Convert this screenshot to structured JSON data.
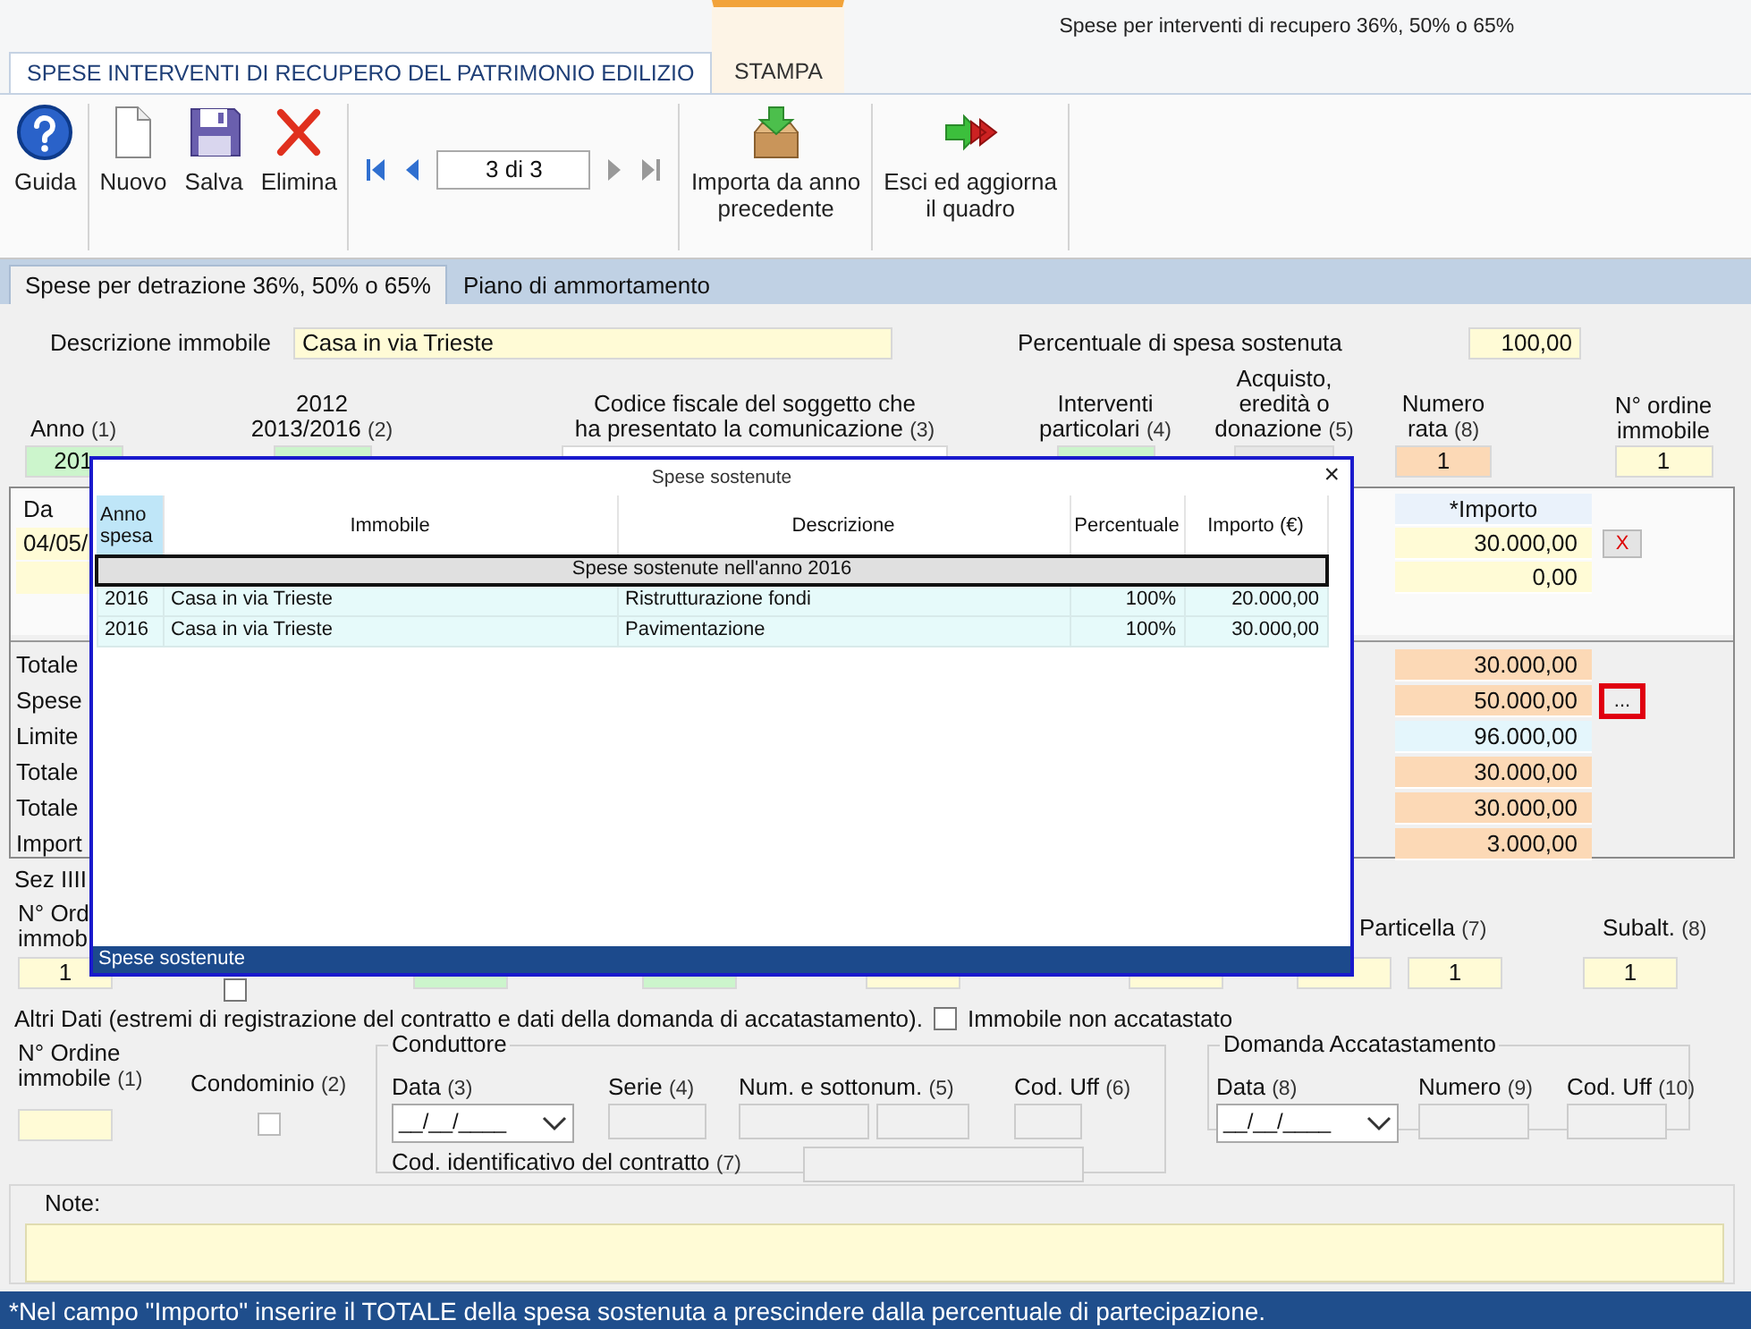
{
  "window": {
    "title": "Spese per interventi di recupero 36%, 50% o 65%"
  },
  "ribbon_tabs": [
    {
      "label": "SPESE INTERVENTI DI RECUPERO DEL PATRIMONIO EDILIZIO",
      "selected": true,
      "contextual": false
    },
    {
      "label": "STAMPA",
      "selected": false,
      "contextual": true
    }
  ],
  "toolbar_groups": [
    [
      {
        "kind": "help",
        "lines": [
          "Guida"
        ]
      }
    ],
    [
      {
        "kind": "new",
        "lines": [
          "Nuovo"
        ]
      },
      {
        "kind": "save",
        "lines": [
          "Salva"
        ]
      },
      {
        "kind": "delete",
        "lines": [
          "Elimina"
        ]
      }
    ],
    [
      {
        "kind": "pager",
        "value": "3 di 3"
      }
    ],
    [
      {
        "kind": "import",
        "lines": [
          "Importa da anno",
          "precedente"
        ]
      }
    ],
    [
      {
        "kind": "exit",
        "lines": [
          "Esci ed aggiorna",
          "il quadro"
        ]
      }
    ]
  ],
  "form_tabs": [
    {
      "label": "Spese per detrazione 36%, 50% o 65%",
      "selected": true
    },
    {
      "label": "Piano di ammortamento",
      "selected": false
    }
  ],
  "descrizione": {
    "label": "Descrizione immobile",
    "value": "Casa in via Trieste"
  },
  "percentuale": {
    "label": "Percentuale di spesa sostenuta",
    "value": "100,00"
  },
  "header_fields": [
    {
      "lines": [
        "Anno"
      ],
      "ref": "(1)",
      "value": "201",
      "color": "#ccf5cc"
    },
    {
      "lines": [
        "2012",
        "2013/2016"
      ],
      "ref": "(2)",
      "color": "#ccf5cc"
    },
    {
      "lines": [
        "Codice fiscale del soggetto che",
        "ha presentato la comunicazione"
      ],
      "ref": "(3)",
      "color": "#ffffff"
    },
    {
      "lines": [
        "Interventi",
        "particolari"
      ],
      "ref": "(4)",
      "color": "#ccf5cc"
    },
    {
      "lines": [
        "Acquisto,",
        "eredità o",
        "donazione"
      ],
      "ref": "(5)",
      "color": "#e6e6e6"
    },
    {
      "lines": [
        "Numero",
        "rata"
      ],
      "ref": "(8)",
      "value": "1",
      "color": "#fcd9b6"
    },
    {
      "lines": [
        "N° ordine",
        "immobile"
      ],
      "value": "1",
      "color": "#fffbd6"
    }
  ],
  "expenses": {
    "columns": [
      "Da",
      "*Importo"
    ],
    "rows": [
      {
        "date": "04/05/",
        "amount": "30.000,00",
        "delete": "X"
      },
      {
        "amount": "0,00"
      }
    ]
  },
  "totals": [
    {
      "label": "Totale",
      "value": "30.000,00",
      "color": "#fcd9b6"
    },
    {
      "label": "Spese",
      "value": "50.000,00",
      "color": "#fcd9b6",
      "button": "...",
      "highlighted": true
    },
    {
      "label": "Limite",
      "value": "96.000,00",
      "color": "#e4f6fc"
    },
    {
      "label": "Totale",
      "value": "30.000,00",
      "color": "#fcd9b6"
    },
    {
      "label": "Totale",
      "value": "30.000,00",
      "color": "#fcd9b6"
    },
    {
      "label": "Import",
      "value": "3.000,00",
      "color": "#fcd9b6"
    }
  ],
  "sez_iiii": {
    "title": "Sez IIII",
    "lead_lines": [
      "N° Ord",
      "immob"
    ],
    "labels": [
      {
        "label": "Particella",
        "ref": "(7)"
      },
      {
        "label": "Subalt.",
        "ref": "(8)"
      }
    ],
    "fields": [
      {
        "kind": "text",
        "value": "1",
        "color": "#fffbd6"
      },
      {
        "kind": "checkbox",
        "checked": false
      },
      {
        "kind": "text",
        "color": "#ccf5cc"
      },
      {
        "kind": "text",
        "color": "#ccf5cc"
      },
      {
        "kind": "text",
        "color": "#fffbd6"
      },
      {
        "kind": "text",
        "color": "#fffbd6"
      },
      {
        "kind": "text",
        "color": "#fffbd6"
      },
      {
        "kind": "text",
        "value": "1",
        "color": "#fffbd6"
      },
      {
        "kind": "text",
        "value": "1",
        "color": "#fffbd6"
      }
    ]
  },
  "altri_dati": {
    "text": "Altri Dati (estremi di registrazione del contratto e dati della domanda di accatastamento).",
    "non_accatastato": {
      "label": "Immobile non accatastato",
      "checked": false
    }
  },
  "ordine": {
    "lines": [
      "N° Ordine",
      "immobile"
    ],
    "ref": "(1)",
    "color": "#fffbd6"
  },
  "condominio": {
    "label": "Condominio",
    "ref": "(2)",
    "checked": false
  },
  "conduttore": {
    "legend": "Conduttore",
    "date": {
      "label": "Data",
      "ref": "(3)",
      "value": "__/__/____"
    },
    "serie": {
      "label": "Serie",
      "ref": "(4)"
    },
    "numero": {
      "label": "Num. e sottonum.",
      "ref": "(5)"
    },
    "cod_uff": {
      "label": "Cod. Uff",
      "ref": "(6)"
    },
    "contratto": {
      "label": "Cod. identificativo del contratto",
      "ref": "(7)"
    }
  },
  "accatastamento": {
    "legend": "Domanda Accatastamento",
    "date": {
      "label": "Data",
      "ref": "(8)",
      "value": "__/__/____"
    },
    "numero": {
      "label": "Numero",
      "ref": "(9)"
    },
    "cod_uff": {
      "label": "Cod. Uff",
      "ref": "(10)"
    }
  },
  "note": {
    "label": "Note:"
  },
  "status_bar": "*Nel campo \"Importo\" inserire il TOTALE della spesa sostenuta a prescindere dalla percentuale di partecipazione.",
  "dialog": {
    "title": "Spese sostenute",
    "close": "×",
    "columns": [
      {
        "label": "Anno spesa",
        "selected": true
      },
      {
        "label": "Immobile",
        "selected": false
      },
      {
        "label": "Descrizione",
        "selected": false
      },
      {
        "label": "Percentuale",
        "selected": false
      },
      {
        "label": "Importo (€)",
        "selected": false
      }
    ],
    "group": "Spese sostenute nell'anno 2016",
    "rows": [
      {
        "cells": [
          "2016",
          "Casa in via Trieste",
          "Ristrutturazione fondi",
          "100%",
          "20.000,00"
        ]
      },
      {
        "cells": [
          "2016",
          "Casa in via Trieste",
          "Pavimentazione",
          "100%",
          "30.000,00"
        ]
      }
    ],
    "footer": "Spese sostenute"
  }
}
